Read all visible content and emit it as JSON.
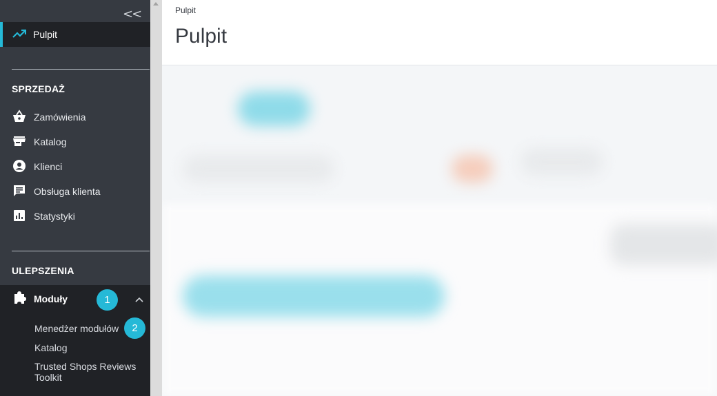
{
  "sidebar": {
    "collapse_glyph": "<<",
    "active_item": {
      "label": "Pulpit",
      "icon": "trending-up-icon"
    },
    "sections": [
      {
        "title": "SPRZEDAŻ",
        "items": [
          {
            "label": "Zamówienia",
            "icon": "basket-icon"
          },
          {
            "label": "Katalog",
            "icon": "store-icon"
          },
          {
            "label": "Klienci",
            "icon": "account-circle-icon"
          },
          {
            "label": "Obsługa klienta",
            "icon": "chat-icon"
          },
          {
            "label": "Statystyki",
            "icon": "bar-chart-icon"
          }
        ]
      },
      {
        "title": "ULEPSZENIA",
        "items": [
          {
            "label": "Moduły",
            "icon": "puzzle-icon",
            "badge": "1",
            "expanded": true,
            "children": [
              {
                "label": "Menedżer modułów",
                "badge": "2"
              },
              {
                "label": "Katalog"
              },
              {
                "label": "Trusted Shops Reviews Toolkit"
              }
            ]
          }
        ]
      }
    ]
  },
  "header": {
    "breadcrumb": "Pulpit",
    "title": "Pulpit"
  },
  "colors": {
    "sidebar_bg": "#363a41",
    "active_bg": "#202226",
    "accent": "#25b9d7",
    "content_bg": "#f4f6f8"
  }
}
